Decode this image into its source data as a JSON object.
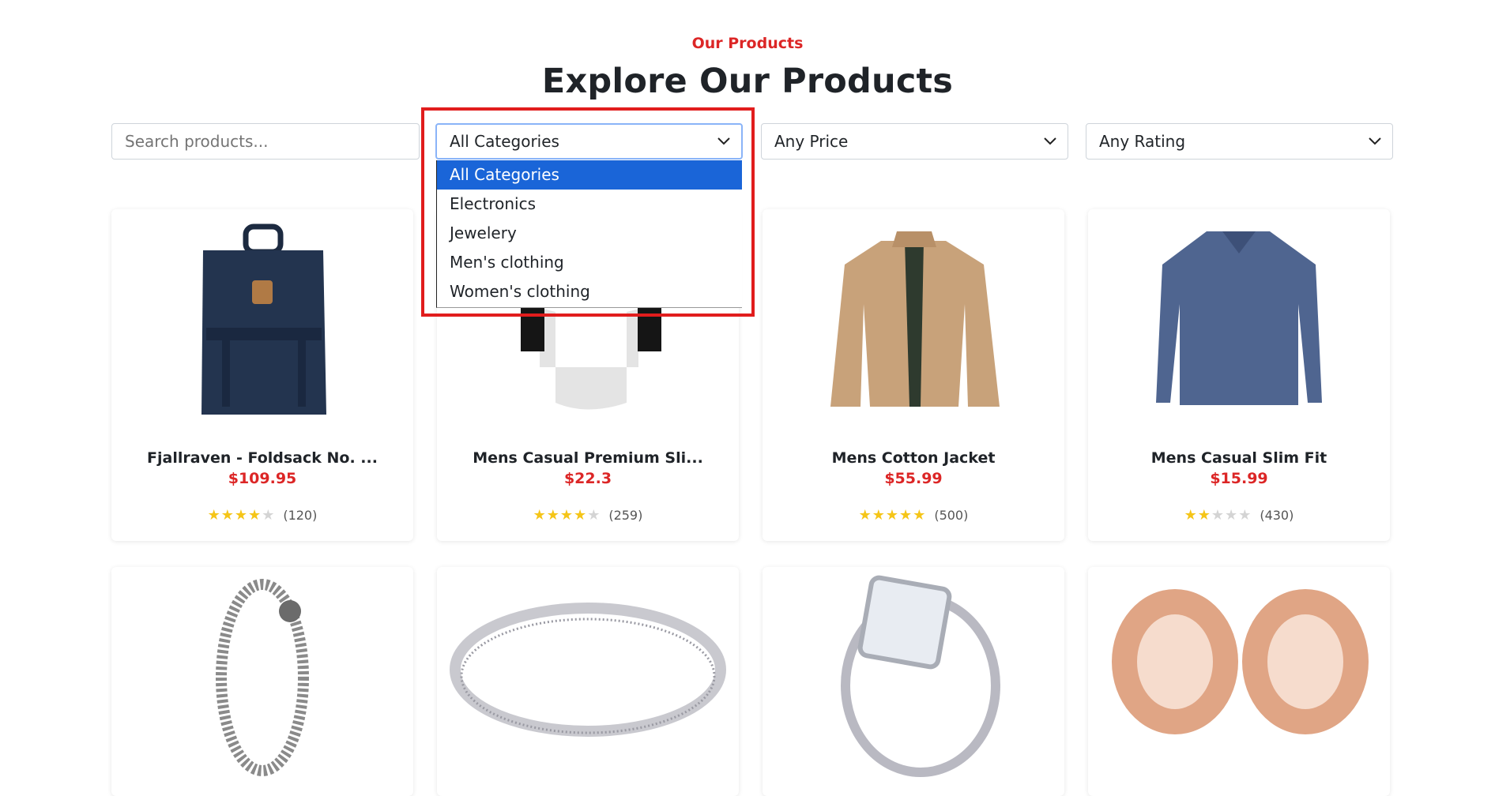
{
  "header": {
    "eyebrow": "Our Products",
    "title": "Explore Our Products"
  },
  "filters": {
    "search_placeholder": "Search products...",
    "category_value": "All Categories",
    "category_options": [
      "All Categories",
      "Electronics",
      "Jewelery",
      "Men's clothing",
      "Women's clothing"
    ],
    "price_value": "Any Price",
    "rating_value": "Any Rating"
  },
  "products": [
    {
      "title": "Fjallraven - Foldsack No. ...",
      "price": "$109.95",
      "rating": 4,
      "count": "(120)"
    },
    {
      "title": "Mens Casual Premium Sli...",
      "price": "$22.3",
      "rating": 4,
      "count": "(259)"
    },
    {
      "title": "Mens Cotton Jacket",
      "price": "$55.99",
      "rating": 5,
      "count": "(500)"
    },
    {
      "title": "Mens Casual Slim Fit",
      "price": "$15.99",
      "rating": 2,
      "count": "(430)"
    },
    {
      "title": "",
      "price": "",
      "rating": 0,
      "count": ""
    },
    {
      "title": "",
      "price": "",
      "rating": 0,
      "count": ""
    },
    {
      "title": "",
      "price": "",
      "rating": 0,
      "count": ""
    },
    {
      "title": "",
      "price": "",
      "rating": 0,
      "count": ""
    }
  ],
  "colors": {
    "accent": "#dc2626",
    "selected": "#1a65d8",
    "star": "#f5c518"
  },
  "icons": [
    "chevron-down-icon"
  ]
}
